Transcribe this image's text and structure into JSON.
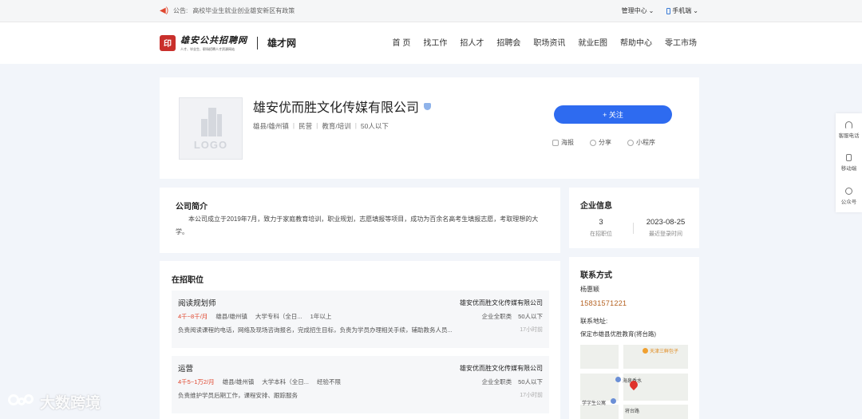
{
  "topbar": {
    "notice_label": "公告:",
    "notice_text": "高校毕业生就业创业雄安新区有政策",
    "admin_center": "管理中心",
    "mobile": "手机端"
  },
  "header": {
    "logo_main": "雄安公共招聘网",
    "logo_sub": "人才、毕业生、职场招聘人才资源网站",
    "logo2": "雄才网",
    "nav": [
      "首 页",
      "找工作",
      "招人才",
      "招聘会",
      "职场资讯",
      "就业E图",
      "帮助中心",
      "零工市场"
    ]
  },
  "company": {
    "logo_placeholder": "LOGO",
    "name": "雄安优而胜文化传媒有限公司",
    "meta": [
      "雄县/雄州镇",
      "民营",
      "教育/培训",
      "50人以下"
    ],
    "follow_label": "+ 关注",
    "actions": [
      "海报",
      "分享",
      "小程序"
    ]
  },
  "intro": {
    "title": "公司简介",
    "text": "本公司成立于2019年7月，致力于家庭教育培训，职业规划，志愿填报等项目，成功为百余名高考生填报志愿，考取理想的大学。"
  },
  "info": {
    "title": "企业信息",
    "positions_count": "3",
    "positions_label": "在招职位",
    "last_login": "2023-08-25",
    "last_login_label": "最近登录时间"
  },
  "jobs": {
    "title": "在招职位",
    "items": [
      {
        "title": "阅读规划师",
        "salary": "4千~8千/月",
        "location": "雄县/雄州镇",
        "education": "大学专科（全日...",
        "experience": "1年以上",
        "desc": "负责阅读课程的电话，网络及现场咨询报名，完成招生目标，负责为学员办理相关手续，辅助教务人员...",
        "company": "雄安优而胜文化传媒有限公司",
        "tag1": "企业全职类",
        "tag2": "50人以下",
        "time": "17小时前"
      },
      {
        "title": "运营",
        "salary": "4千5~1万2/月",
        "location": "雄县/雄州镇",
        "education": "大学本科（全日...",
        "experience": "经验不限",
        "desc": "负责维护学员后期工作，课程安排、跟踪服务",
        "company": "雄安优而胜文化传媒有限公司",
        "tag1": "企业全职类",
        "tag2": "50人以下",
        "time": "17小时前"
      }
    ]
  },
  "contact": {
    "title": "联系方式",
    "person": "杨惠颖",
    "phone": "15831571221",
    "address_label": "联系地址:",
    "address": "保定市雄县优胜教育(将台路)",
    "map_labels": [
      "天津三鲜包子",
      "海泉香水",
      "学字生公寓",
      "将台路"
    ]
  },
  "float": {
    "items": [
      "客服电话",
      "移动端",
      "公众号"
    ]
  },
  "watermark": "大数跨境"
}
